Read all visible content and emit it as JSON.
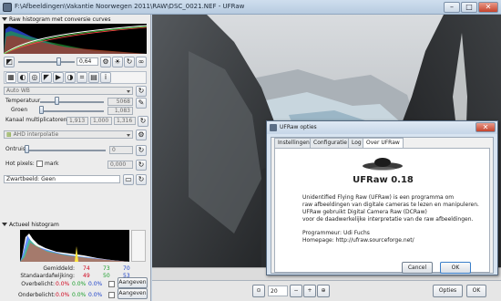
{
  "window": {
    "title": "F:\\Afbeeldingen\\Vakantie Noorwegen 2011\\RAW\\DSC_0021.NEF - UFRaw",
    "minimize": "–",
    "maximize": "□",
    "close": "✕"
  },
  "raw_histogram": {
    "header": "Raw histogram met conversie curves"
  },
  "exposure": {
    "value": "0,64"
  },
  "white_balance": {
    "mode": "Auto WB",
    "temperature_label": "Temperatuur",
    "temperature_value": "5068",
    "green_label": "Groen",
    "green_value": "1,083",
    "multipliers_label": "Kanaal multiplicatoren",
    "mult_r": "1,913",
    "mult_g": "1,000",
    "mult_b": "1,316"
  },
  "interpolation": {
    "mode": "AHD interpolatie"
  },
  "denoise": {
    "label": "Ontruis",
    "value": "0"
  },
  "hot_pixels": {
    "label": "Hot pixels: 0",
    "mark_label": "mark",
    "value": "0,000"
  },
  "dark_frame": {
    "label": "Zwartbeeld:",
    "value": "Geen"
  },
  "live_histogram": {
    "header": "Actueel histogram",
    "mean_label": "Gemiddeld:",
    "std_label": "Standaardafwijking:",
    "over_label": "Overbelicht:",
    "under_label": "Onderbelicht:",
    "mean": [
      "74",
      "73",
      "70"
    ],
    "std": [
      "49",
      "50",
      "53"
    ],
    "over": [
      "0.0%",
      "0.0%",
      "0.0%"
    ],
    "under": [
      "0.0%",
      "0.0%",
      "0.0%"
    ],
    "apply_label": "Aangeven",
    "colors": {
      "r": "#d0021b",
      "g": "#1a9e2a",
      "b": "#1f43c9"
    }
  },
  "statusbar": {
    "zoom": "20",
    "options_label": "Opties",
    "ok_label": "OK"
  },
  "dialog": {
    "title": "UFRaw opties",
    "tabs": [
      "Instellingen",
      "Configuratie",
      "Log",
      "Over UFRaw"
    ],
    "product": "UFRaw 0.18",
    "lines": [
      "Unidentified Flying Raw (UFRaw) is een programma om",
      "raw afbeeldingen van digitale cameras te lezen en manipuleren.",
      "UFRaw gebruikt Digital Camera Raw (DCRaw)",
      "voor de daadwerkelijke interpretatie van de raw afbeeldingen."
    ],
    "programmer": "Programmeur: Udi Fuchs",
    "homepage": "Homepage: http://ufraw.sourceforge.net/",
    "cancel_label": "Cancel",
    "ok_label": "OK"
  }
}
